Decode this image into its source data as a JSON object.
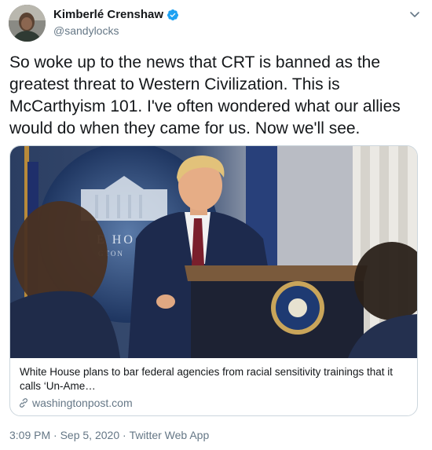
{
  "author": {
    "name": "Kimberlé Crenshaw",
    "handle": "@sandylocks",
    "verified": true
  },
  "tweet": {
    "text": "So woke up to the news that CRT is banned as the greatest threat to Western Civilization. This is McCarthyism 101. I've often wondered what our allies would do when they came for us. Now we'll see."
  },
  "card": {
    "image_seal_text": "E HO",
    "image_seal_text_small": "GTON",
    "title": "White House plans to bar federal agencies from racial sensitivity trainings that it calls ‘Un-Ame…",
    "domain": "washingtonpost.com"
  },
  "meta": {
    "time": "3:09 PM",
    "separator": " · ",
    "date": "Sep 5, 2020",
    "source": "Twitter Web App"
  },
  "icons": {
    "verified": "verified-badge-icon",
    "more": "chevron-down-icon",
    "link": "link-icon"
  },
  "colors": {
    "text": "#14171a",
    "secondary": "#657786",
    "verified_blue": "#1da1f2",
    "border": "#ccd6dd"
  }
}
